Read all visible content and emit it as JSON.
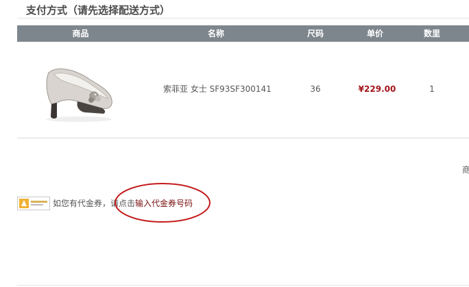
{
  "section": {
    "title": "支付方式（请先选择配送方式）"
  },
  "table": {
    "headers": {
      "product": "商品",
      "name": "名称",
      "size": "尺码",
      "price": "单价",
      "quantity": "数里"
    },
    "rows": [
      {
        "image_icon": "shoe-product-image",
        "name": "索菲亚 女士 SF93SF300141",
        "size": "36",
        "price": "¥229.00",
        "quantity": "1"
      }
    ]
  },
  "summary": {
    "cut_text": "商"
  },
  "coupon": {
    "logo_icon": "coupon-logo-icon",
    "prompt_prefix": "如您有代金券，请点击",
    "link_text": "输入代金券号码"
  },
  "annotation": {
    "ellipse_color": "#c41a1a"
  },
  "colors": {
    "header_bg": "#7e868d",
    "price": "#a5141a",
    "link": "#7a1010"
  }
}
